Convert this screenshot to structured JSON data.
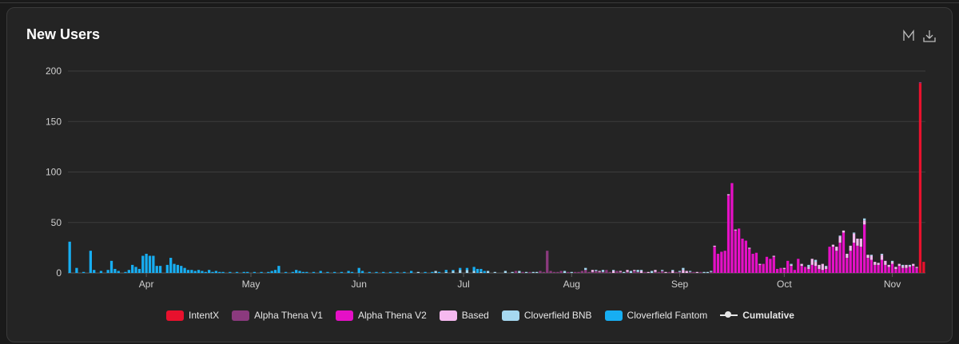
{
  "title": "New Users",
  "tools": {
    "zoom_icon": "zoom-icon",
    "download_icon": "download-icon"
  },
  "chart_data": {
    "type": "bar",
    "stacked": true,
    "title": "New Users",
    "xlabel": "",
    "ylabel": "",
    "ylim": [
      0,
      200
    ],
    "y_ticks": [
      0,
      50,
      100,
      150,
      200
    ],
    "x_tick_labels": [
      "Apr",
      "May",
      "Jun",
      "Jul",
      "Aug",
      "Sep",
      "Oct",
      "Nov"
    ],
    "x_tick_index": [
      22,
      52,
      83,
      113,
      144,
      175,
      205,
      236
    ],
    "grid": true,
    "legend_position": "bottom",
    "series": [
      {
        "name": "IntentX",
        "color": "#e8112d",
        "points": [
          [
            244,
            188
          ],
          [
            245,
            11
          ]
        ]
      },
      {
        "name": "Alpha Thena V1",
        "color": "#8b3a7e",
        "points": [
          [
            128,
            2
          ],
          [
            130,
            1
          ],
          [
            132,
            1
          ],
          [
            135,
            2
          ],
          [
            136,
            1
          ],
          [
            138,
            2
          ],
          [
            139,
            1
          ],
          [
            140,
            1
          ],
          [
            141,
            2
          ],
          [
            143,
            1
          ],
          [
            145,
            1
          ],
          [
            146,
            1
          ],
          [
            147,
            2
          ],
          [
            150,
            1
          ],
          [
            151,
            2
          ],
          [
            152,
            1
          ],
          [
            153,
            1
          ],
          [
            155,
            1
          ],
          [
            158,
            1
          ],
          [
            160,
            1
          ],
          [
            163,
            1
          ],
          [
            165,
            1
          ],
          [
            168,
            1
          ],
          [
            170,
            2
          ],
          [
            172,
            1
          ],
          [
            175,
            1
          ],
          [
            178,
            1
          ],
          [
            181,
            1
          ],
          [
            184,
            1
          ],
          [
            137,
            22
          ],
          [
            148,
            3
          ],
          [
            149,
            1
          ],
          [
            154,
            3
          ],
          [
            157,
            2
          ],
          [
            162,
            2
          ],
          [
            169,
            1
          ],
          [
            174,
            1
          ],
          [
            179,
            1
          ],
          [
            244,
            1
          ]
        ]
      },
      {
        "name": "Alpha Thena V2",
        "color": "#e510c6",
        "points": [
          [
            185,
            26
          ],
          [
            186,
            19
          ],
          [
            187,
            21
          ],
          [
            188,
            22
          ],
          [
            189,
            77
          ],
          [
            190,
            89
          ],
          [
            191,
            42
          ],
          [
            192,
            44
          ],
          [
            193,
            34
          ],
          [
            194,
            32
          ],
          [
            195,
            24
          ],
          [
            196,
            19
          ],
          [
            197,
            20
          ],
          [
            198,
            8
          ],
          [
            199,
            9
          ],
          [
            200,
            16
          ],
          [
            201,
            14
          ],
          [
            202,
            16
          ],
          [
            203,
            4
          ],
          [
            204,
            5
          ],
          [
            205,
            4
          ],
          [
            206,
            12
          ],
          [
            207,
            7
          ],
          [
            208,
            3
          ],
          [
            209,
            14
          ],
          [
            210,
            7
          ],
          [
            211,
            6
          ],
          [
            212,
            4
          ],
          [
            213,
            8
          ],
          [
            214,
            7
          ],
          [
            215,
            4
          ],
          [
            216,
            3
          ],
          [
            217,
            4
          ],
          [
            218,
            26
          ],
          [
            219,
            26
          ],
          [
            220,
            22
          ],
          [
            221,
            30
          ],
          [
            222,
            40
          ],
          [
            223,
            15
          ],
          [
            224,
            22
          ],
          [
            225,
            30
          ],
          [
            226,
            27
          ],
          [
            227,
            26
          ],
          [
            228,
            48
          ],
          [
            229,
            15
          ],
          [
            230,
            13
          ],
          [
            231,
            8
          ],
          [
            232,
            8
          ],
          [
            233,
            13
          ],
          [
            234,
            8
          ],
          [
            235,
            6
          ],
          [
            236,
            9
          ],
          [
            237,
            4
          ],
          [
            238,
            7
          ],
          [
            239,
            5
          ],
          [
            240,
            5
          ],
          [
            241,
            6
          ],
          [
            242,
            7
          ],
          [
            243,
            5
          ]
        ]
      },
      {
        "name": "Based",
        "color": "#f5b9ef",
        "points": [
          [
            150,
            2
          ],
          [
            152,
            1
          ],
          [
            156,
            2
          ],
          [
            158,
            1
          ],
          [
            160,
            2
          ],
          [
            162,
            1
          ],
          [
            164,
            2
          ],
          [
            166,
            1
          ],
          [
            168,
            2
          ],
          [
            171,
            1
          ],
          [
            173,
            2
          ],
          [
            176,
            3
          ],
          [
            177,
            2
          ],
          [
            180,
            1
          ],
          [
            185,
            1
          ],
          [
            189,
            1
          ],
          [
            191,
            1
          ],
          [
            195,
            1
          ],
          [
            198,
            1
          ],
          [
            202,
            1
          ],
          [
            205,
            1
          ],
          [
            207,
            1
          ],
          [
            210,
            2
          ],
          [
            212,
            2
          ],
          [
            213,
            6
          ],
          [
            214,
            4
          ],
          [
            215,
            4
          ],
          [
            216,
            6
          ],
          [
            217,
            2
          ],
          [
            219,
            2
          ],
          [
            220,
            4
          ],
          [
            221,
            6
          ],
          [
            222,
            2
          ],
          [
            223,
            4
          ],
          [
            224,
            5
          ],
          [
            225,
            9
          ],
          [
            226,
            7
          ],
          [
            227,
            8
          ],
          [
            228,
            4
          ],
          [
            229,
            3
          ],
          [
            230,
            4
          ],
          [
            231,
            3
          ],
          [
            232,
            2
          ],
          [
            233,
            5
          ],
          [
            234,
            4
          ],
          [
            235,
            2
          ],
          [
            236,
            2
          ],
          [
            237,
            2
          ],
          [
            238,
            2
          ],
          [
            239,
            2
          ],
          [
            240,
            3
          ],
          [
            241,
            1
          ],
          [
            242,
            2
          ],
          [
            243,
            1
          ]
        ]
      },
      {
        "name": "Cloverfield BNB",
        "color": "#a6d8f0",
        "points": [
          [
            100,
            1
          ],
          [
            105,
            2
          ],
          [
            108,
            1
          ],
          [
            110,
            2
          ],
          [
            112,
            3
          ],
          [
            114,
            3
          ],
          [
            116,
            2
          ],
          [
            118,
            1
          ],
          [
            120,
            2
          ],
          [
            122,
            1
          ],
          [
            125,
            2
          ],
          [
            127,
            1
          ],
          [
            129,
            2
          ],
          [
            131,
            1
          ],
          [
            133,
            1
          ],
          [
            134,
            1
          ],
          [
            142,
            2
          ],
          [
            144,
            1
          ],
          [
            148,
            2
          ],
          [
            151,
            1
          ],
          [
            153,
            2
          ],
          [
            156,
            1
          ],
          [
            159,
            1
          ],
          [
            161,
            2
          ],
          [
            163,
            2
          ],
          [
            164,
            1
          ],
          [
            167,
            2
          ],
          [
            170,
            1
          ],
          [
            173,
            1
          ],
          [
            175,
            1
          ],
          [
            176,
            2
          ],
          [
            178,
            1
          ],
          [
            182,
            1
          ],
          [
            183,
            1
          ],
          [
            184,
            1
          ],
          [
            207,
            1
          ],
          [
            212,
            2
          ],
          [
            214,
            2
          ],
          [
            217,
            1
          ],
          [
            221,
            1
          ],
          [
            225,
            1
          ],
          [
            228,
            2
          ],
          [
            230,
            1
          ],
          [
            233,
            1
          ],
          [
            236,
            1
          ],
          [
            239,
            1
          ],
          [
            241,
            1
          ]
        ]
      },
      {
        "name": "Cloverfield Fantom",
        "color": "#17aef2",
        "points": [
          [
            0,
            31
          ],
          [
            2,
            5
          ],
          [
            4,
            1
          ],
          [
            6,
            22
          ],
          [
            7,
            3
          ],
          [
            9,
            2
          ],
          [
            11,
            3
          ],
          [
            12,
            12
          ],
          [
            13,
            4
          ],
          [
            14,
            2
          ],
          [
            16,
            1
          ],
          [
            17,
            3
          ],
          [
            18,
            8
          ],
          [
            19,
            6
          ],
          [
            20,
            4
          ],
          [
            21,
            17
          ],
          [
            22,
            19
          ],
          [
            23,
            17
          ],
          [
            24,
            17
          ],
          [
            25,
            7
          ],
          [
            26,
            7
          ],
          [
            28,
            8
          ],
          [
            29,
            15
          ],
          [
            30,
            9
          ],
          [
            31,
            8
          ],
          [
            32,
            7
          ],
          [
            33,
            5
          ],
          [
            34,
            3
          ],
          [
            35,
            3
          ],
          [
            36,
            2
          ],
          [
            37,
            3
          ],
          [
            38,
            2
          ],
          [
            39,
            1
          ],
          [
            40,
            3
          ],
          [
            41,
            1
          ],
          [
            42,
            2
          ],
          [
            43,
            1
          ],
          [
            44,
            1
          ],
          [
            46,
            1
          ],
          [
            48,
            1
          ],
          [
            50,
            1
          ],
          [
            51,
            1
          ],
          [
            53,
            1
          ],
          [
            55,
            1
          ],
          [
            57,
            1
          ],
          [
            58,
            2
          ],
          [
            59,
            3
          ],
          [
            60,
            7
          ],
          [
            62,
            1
          ],
          [
            64,
            1
          ],
          [
            65,
            3
          ],
          [
            66,
            2
          ],
          [
            67,
            1
          ],
          [
            68,
            1
          ],
          [
            70,
            1
          ],
          [
            72,
            2
          ],
          [
            74,
            1
          ],
          [
            76,
            1
          ],
          [
            78,
            1
          ],
          [
            80,
            2
          ],
          [
            81,
            1
          ],
          [
            83,
            5
          ],
          [
            84,
            2
          ],
          [
            86,
            1
          ],
          [
            88,
            1
          ],
          [
            90,
            1
          ],
          [
            92,
            1
          ],
          [
            94,
            1
          ],
          [
            96,
            1
          ],
          [
            98,
            2
          ],
          [
            102,
            1
          ],
          [
            104,
            1
          ],
          [
            106,
            1
          ],
          [
            108,
            2
          ],
          [
            110,
            1
          ],
          [
            112,
            2
          ],
          [
            114,
            2
          ],
          [
            116,
            4
          ],
          [
            117,
            4
          ],
          [
            118,
            3
          ],
          [
            119,
            2
          ]
        ]
      }
    ],
    "legend": [
      "IntentX",
      "Alpha Thena V1",
      "Alpha Thena V2",
      "Based",
      "Cloverfield BNB",
      "Cloverfield Fantom",
      "Cumulative"
    ],
    "cumulative_color": "#e6e6e6"
  }
}
